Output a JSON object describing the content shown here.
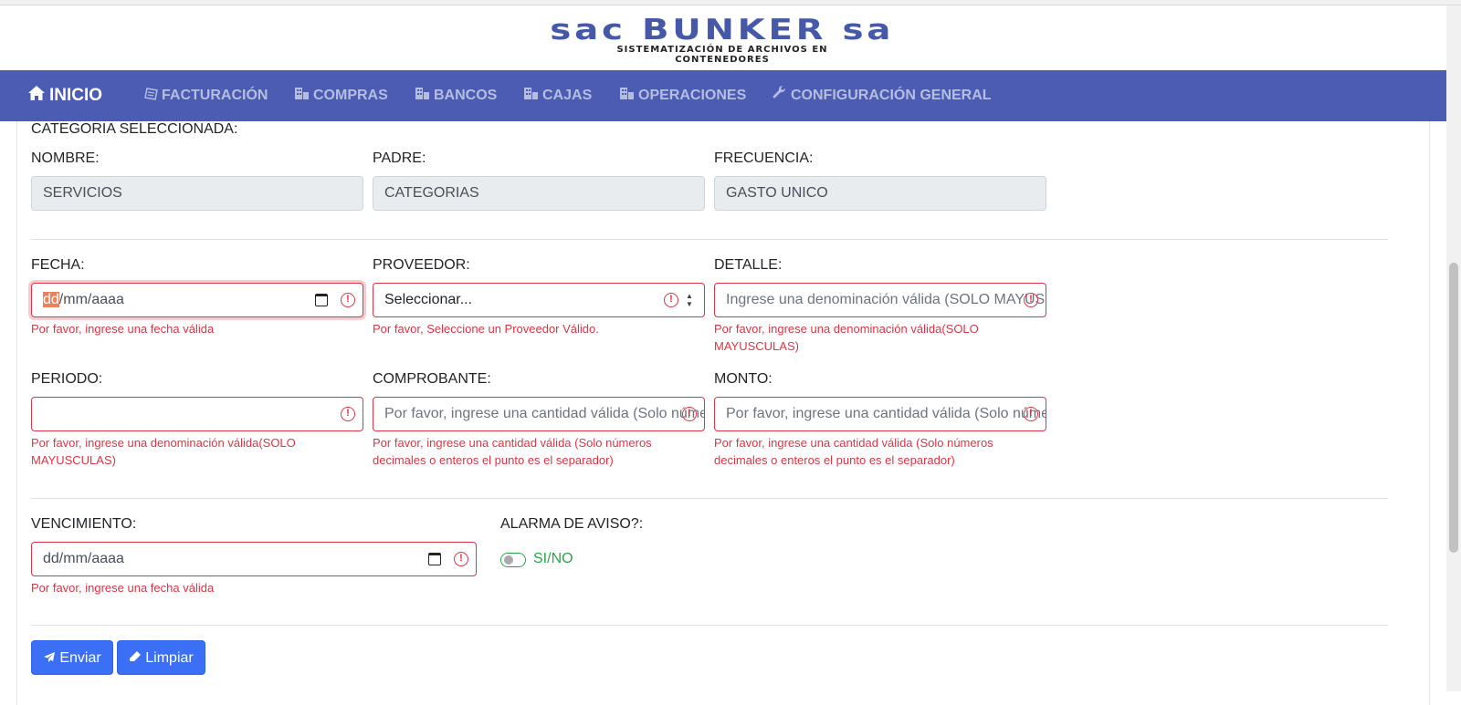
{
  "brand": {
    "name": "sac BUNKER sa",
    "tagline": "SISTEMATIZACIÓN DE ARCHIVOS EN CONTENEDORES"
  },
  "nav": {
    "home": "INICIO",
    "items": [
      "FACTURACIÓN",
      "COMPRAS",
      "BANCOS",
      "CAJAS",
      "OPERACIONES",
      "CONFIGURACIÓN GENERAL"
    ],
    "icons": [
      "home-icon",
      "invoice-icon",
      "building-icon",
      "building-icon",
      "building-icon",
      "building-icon",
      "wrench-icon"
    ]
  },
  "category": {
    "heading": "CATEGORIA SELECCIONADA:",
    "nombre_label": "NOMBRE:",
    "nombre_value": "SERVICIOS",
    "padre_label": "PADRE:",
    "padre_value": "CATEGORIAS",
    "frecuencia_label": "FRECUENCIA:",
    "frecuencia_value": "GASTO UNICO"
  },
  "form": {
    "fecha": {
      "label": "FECHA:",
      "day": "dd",
      "rest": "/mm/aaaa",
      "error": "Por favor, ingrese una fecha válida"
    },
    "proveedor": {
      "label": "PROVEEDOR:",
      "selected": "Seleccionar...",
      "error": "Por favor, Seleccione un Proveedor Válido."
    },
    "detalle": {
      "label": "DETALLE:",
      "placeholder": "Ingrese una denominación válida (SOLO MAYUSCULAS)",
      "error": "Por favor, ingrese una denominación válida(SOLO MAYUSCULAS)"
    },
    "periodo": {
      "label": "PERIODO:",
      "value": "",
      "error": "Por favor, ingrese una denominación válida(SOLO MAYUSCULAS)"
    },
    "comprobante": {
      "label": "COMPROBANTE:",
      "placeholder": "Por favor, ingrese una cantidad  válida (Solo números decimales o enteros)",
      "error": "Por favor, ingrese una cantidad válida (Solo números decimales o enteros el punto es el separador)"
    },
    "monto": {
      "label": "MONTO:",
      "placeholder": "Por favor, ingrese una cantidad  válida (Solo números decimales o enteros)",
      "error": "Por favor, ingrese una cantidad válida (Solo números decimales o enteros el punto es el separador)"
    },
    "vencimiento": {
      "label": "VENCIMIENTO:",
      "value": "dd/mm/aaaa",
      "error": "Por favor, ingrese una fecha válida"
    },
    "alarma": {
      "label": "ALARMA DE AVISO?:",
      "toggle_label": "SI/NO",
      "checked": false
    }
  },
  "buttons": {
    "submit": "Enviar",
    "clear": "Limpiar"
  },
  "colors": {
    "navbar": "#4b5cb2",
    "invalid": "#dc3545",
    "primary": "#3b6ff5",
    "success": "#28a745"
  }
}
